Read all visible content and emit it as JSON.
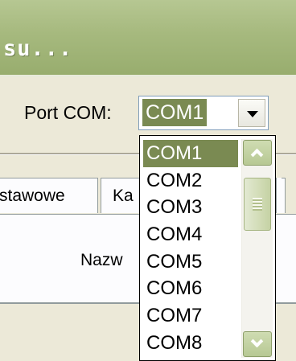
{
  "window": {
    "title_fragment": "su..."
  },
  "port_row": {
    "label": "Port COM:",
    "selected_value": "COM1"
  },
  "tabs": [
    {
      "label": "stawowe"
    },
    {
      "label": "Ka"
    }
  ],
  "panel": {
    "name_label": "Nazw"
  },
  "dropdown": {
    "options": [
      "COM1",
      "COM2",
      "COM3",
      "COM4",
      "COM5",
      "COM6",
      "COM7",
      "COM8"
    ],
    "selected_index": 0
  },
  "icons": {
    "combo_arrow": "chevron-down-icon",
    "scroll_up": "scroll-up-icon",
    "scroll_down": "scroll-down-icon"
  },
  "colors": {
    "titlebar": "#a6b97e",
    "selection": "#7a8a52",
    "dialog": "#ece9d8",
    "scrollbar": "#b7c894"
  }
}
